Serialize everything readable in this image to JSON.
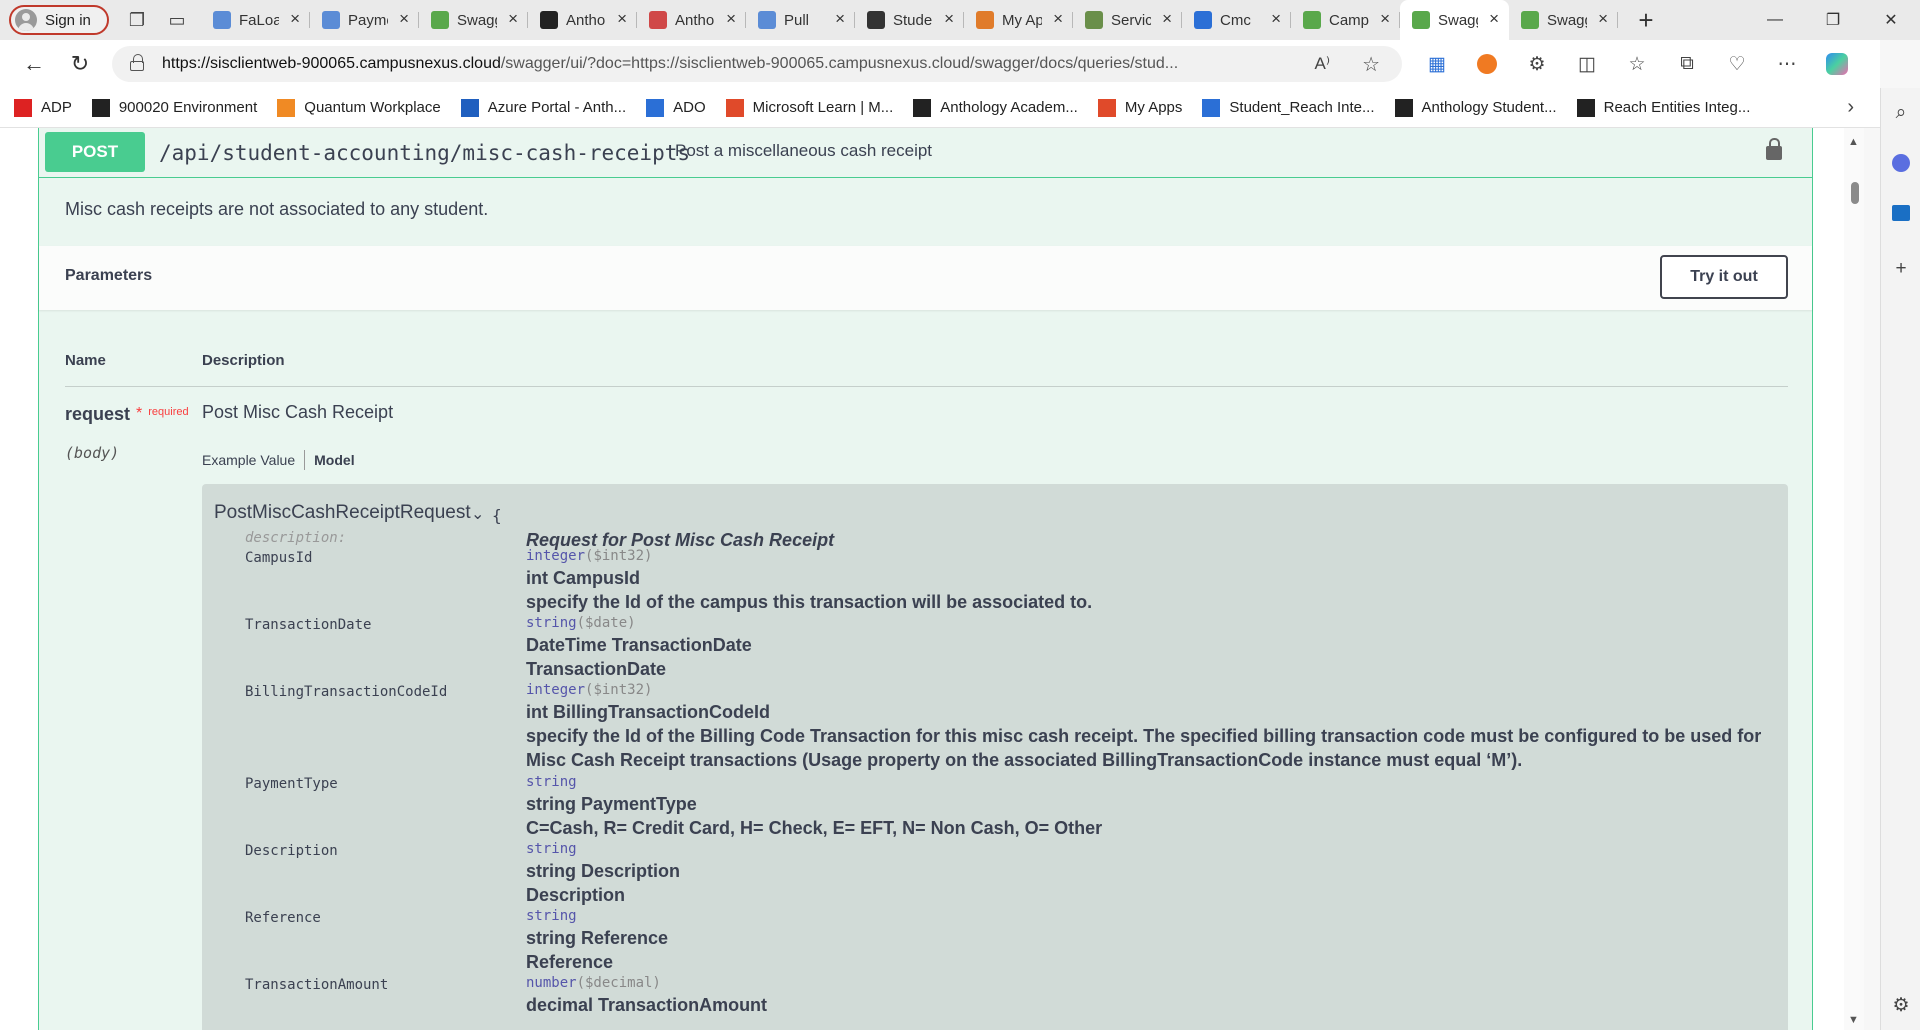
{
  "browser": {
    "sign_in": "Sign in",
    "tabs": [
      {
        "title": "FaLoan",
        "color": "#5b8cd6"
      },
      {
        "title": "Payments",
        "color": "#5b8cd6"
      },
      {
        "title": "Swagger",
        "color": "#59a84b"
      },
      {
        "title": "Anthology",
        "color": "#222222"
      },
      {
        "title": "Anthology",
        "color": "#d04848"
      },
      {
        "title": "Pull",
        "color": "#5b8cd6"
      },
      {
        "title": "Student",
        "color": "#333333"
      },
      {
        "title": "My Apps",
        "color": "#e07b2a"
      },
      {
        "title": "Service",
        "color": "#6a8f4a"
      },
      {
        "title": "Cmc",
        "color": "#2b6fd6"
      },
      {
        "title": "Campus",
        "color": "#59a84b"
      },
      {
        "title": "Swagger",
        "color": "#59a84b",
        "active": true
      },
      {
        "title": "Swagger",
        "color": "#59a84b"
      }
    ],
    "url_host": "https://sisclientweb-900065.campusnexus.cloud",
    "url_rest": "/swagger/ui/?doc=https://sisclientweb-900065.campusnexus.cloud/swagger/docs/queries/stud...",
    "bookmarks": [
      {
        "label": "ADP",
        "color": "#d22"
      },
      {
        "label": "900020 Environment",
        "color": "#222"
      },
      {
        "label": "Quantum Workplace",
        "color": "#f08a24"
      },
      {
        "label": "Azure Portal - Anth...",
        "color": "#1f5fbf"
      },
      {
        "label": "ADO",
        "color": "#2b6fd6"
      },
      {
        "label": "Microsoft Learn | M...",
        "color": "#e04a2a"
      },
      {
        "label": "Anthology Academ...",
        "color": "#222"
      },
      {
        "label": "My Apps",
        "color": "#e04a2a"
      },
      {
        "label": "Student_Reach Inte...",
        "color": "#2b6fd6"
      },
      {
        "label": "Anthology Student...",
        "color": "#222"
      },
      {
        "label": "Reach Entities Integ...",
        "color": "#222"
      }
    ]
  },
  "operation": {
    "method": "POST",
    "path": "/api/student-accounting/misc-cash-receipts",
    "summary": "Post a miscellaneous cash receipt",
    "description": "Misc cash receipts are not associated to any student.",
    "parameters_label": "Parameters",
    "try_it_out": "Try it out",
    "col_name": "Name",
    "col_description": "Description",
    "param": {
      "name": "request",
      "required": "required",
      "in": "(body)",
      "description": "Post Misc Cash Receipt",
      "example_tab": "Example Value",
      "model_tab": "Model"
    }
  },
  "model": {
    "name": "PostMiscCashReceiptRequest",
    "brace": "{",
    "description_key": "description:",
    "description_value": "Request for Post Misc Cash Receipt",
    "props": [
      {
        "key": "CampusId",
        "type": "integer",
        "fmt": "($int32)",
        "line1": "int CampusId",
        "line2": "specify the Id of the campus this transaction will be associated to."
      },
      {
        "key": "TransactionDate",
        "type": "string",
        "fmt": "($date)",
        "line1": "DateTime TransactionDate",
        "line2": "TransactionDate"
      },
      {
        "key": "BillingTransactionCodeId",
        "type": "integer",
        "fmt": "($int32)",
        "line1": "int BillingTransactionCodeId",
        "line2": "specify the Id of the Billing Code Transaction for this misc cash receipt. The specified billing transaction code must be configured to be used for",
        "line3": "Misc Cash Receipt transactions (Usage property on the associated BillingTransactionCode instance must equal ‘M’)."
      },
      {
        "key": "PaymentType",
        "type": "string",
        "fmt": "",
        "line1": "string PaymentType",
        "line2": "C=Cash, R= Credit Card, H= Check, E= EFT, N= Non Cash, O= Other"
      },
      {
        "key": "Description",
        "type": "string",
        "fmt": "",
        "line1": "string Description",
        "line2": "Description"
      },
      {
        "key": "Reference",
        "type": "string",
        "fmt": "",
        "line1": "string Reference",
        "line2": "Reference"
      },
      {
        "key": "TransactionAmount",
        "type": "number",
        "fmt": "($decimal)",
        "line1": "decimal TransactionAmount",
        "line2": ""
      }
    ]
  }
}
